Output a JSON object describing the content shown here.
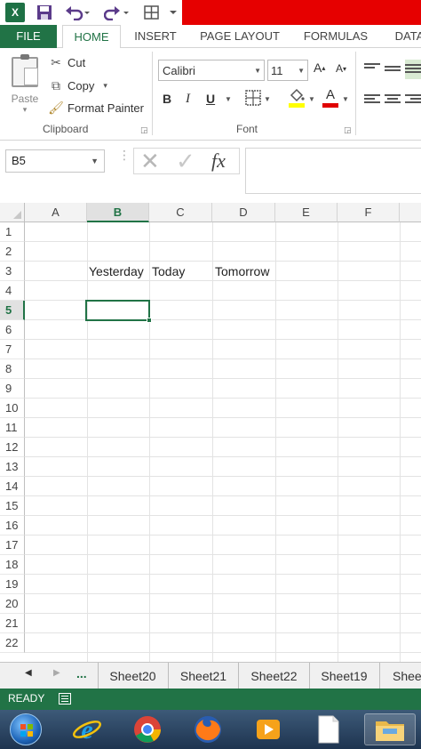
{
  "quick_access": {
    "app_icon": "excel-icon",
    "app_letter": "X",
    "icons": [
      "save-icon",
      "undo-icon",
      "redo-icon",
      "quick-access-icon"
    ]
  },
  "tabs": {
    "file": "FILE",
    "home": "HOME",
    "insert": "INSERT",
    "page_layout": "PAGE LAYOUT",
    "formulas": "FORMULAS",
    "data": "DATA"
  },
  "ribbon": {
    "clipboard": {
      "paste": "Paste",
      "cut": "Cut",
      "copy": "Copy",
      "format_painter": "Format Painter",
      "group_label": "Clipboard"
    },
    "font": {
      "font_name": "Calibri",
      "font_size": "11",
      "bold": "B",
      "italic": "I",
      "underline": "U",
      "grow": "A",
      "shrink": "A",
      "group_label": "Font",
      "fill_color": "#ffff00",
      "font_color": "#e00000"
    }
  },
  "formula_bar": {
    "name_box": "B5",
    "fx": "fx",
    "formula": ""
  },
  "grid": {
    "columns": [
      "A",
      "B",
      "C",
      "D",
      "E",
      "F"
    ],
    "selected_column": "B",
    "rows": [
      "1",
      "2",
      "3",
      "4",
      "5",
      "6",
      "7",
      "8",
      "9",
      "10",
      "11",
      "12",
      "13",
      "14",
      "15",
      "16",
      "17",
      "18",
      "19",
      "20",
      "21",
      "22"
    ],
    "selected_row": "5",
    "cells": {
      "B3": "Yesterday",
      "C3": "Today",
      "D3": "Tomorrow"
    }
  },
  "sheets": {
    "more": "...",
    "tabs": [
      "Sheet20",
      "Sheet21",
      "Sheet22",
      "Sheet19",
      "Sheet"
    ]
  },
  "status": {
    "ready": "READY"
  },
  "colors": {
    "accent": "#217346",
    "title_bar": "#e60000"
  }
}
